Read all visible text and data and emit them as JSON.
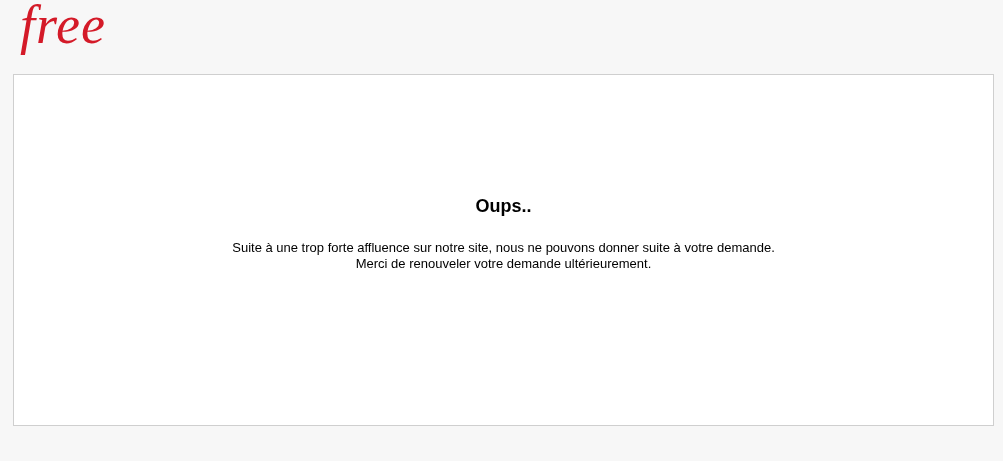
{
  "logo": {
    "text": "free"
  },
  "card": {
    "title": "Oups..",
    "message_lines": [
      "Suite à une trop forte affluence sur notre site, nous ne pouvons donner suite à votre demande.",
      "Merci de renouveler votre demande ultérieurement."
    ]
  }
}
